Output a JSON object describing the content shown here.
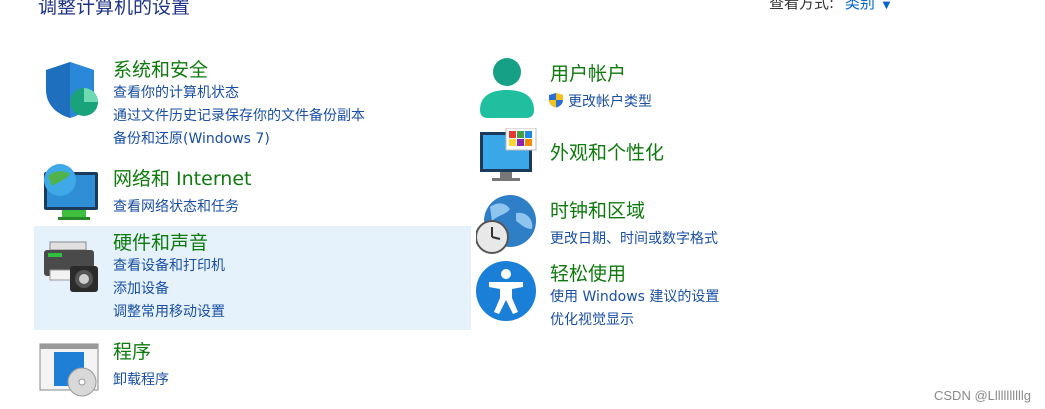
{
  "header": {
    "title": "调整计算机的设置",
    "view_by_label": "查看方式:",
    "view_by_value": "类别"
  },
  "categories": {
    "system_security": {
      "title": "系统和安全",
      "links": [
        "查看你的计算机状态",
        "通过文件历史记录保存你的文件备份副本",
        "备份和还原(Windows 7)"
      ]
    },
    "network": {
      "title": "网络和 Internet",
      "links": [
        "查看网络状态和任务"
      ]
    },
    "hardware": {
      "title": "硬件和声音",
      "links": [
        "查看设备和打印机",
        "添加设备",
        "调整常用移动设置"
      ]
    },
    "programs": {
      "title": "程序",
      "links": [
        "卸载程序"
      ]
    },
    "user_accounts": {
      "title": "用户帐户",
      "links": [
        "更改帐户类型"
      ]
    },
    "appearance": {
      "title": "外观和个性化",
      "links": []
    },
    "clock_region": {
      "title": "时钟和区域",
      "links": [
        "更改日期、时间或数字格式"
      ]
    },
    "ease_of_access": {
      "title": "轻松使用",
      "links": [
        "使用 Windows 建议的设置",
        "优化视觉显示"
      ]
    }
  },
  "watermark": "CSDN @Lllllllllllg"
}
